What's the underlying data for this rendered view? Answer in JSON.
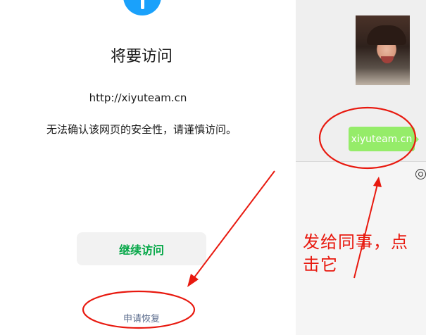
{
  "warning_page": {
    "title": "将要访问",
    "url": "http://xiyuteam.cn",
    "message": "无法确认该网页的安全性，请谨慎访问。",
    "continue_label": "继续访问",
    "appeal_label": "申请恢复",
    "icon": "info-icon"
  },
  "chat": {
    "bubble_text": "xiyuteam.cn",
    "image": "photo-of-child",
    "toolbar_icon": "emoji-icon"
  },
  "annotation": {
    "note": "发给同事，点击它",
    "color": "#e8190f"
  },
  "colors": {
    "accent_blue": "#1aa1fb",
    "continue_green": "#07a849",
    "bubble_green": "#95ec69"
  }
}
